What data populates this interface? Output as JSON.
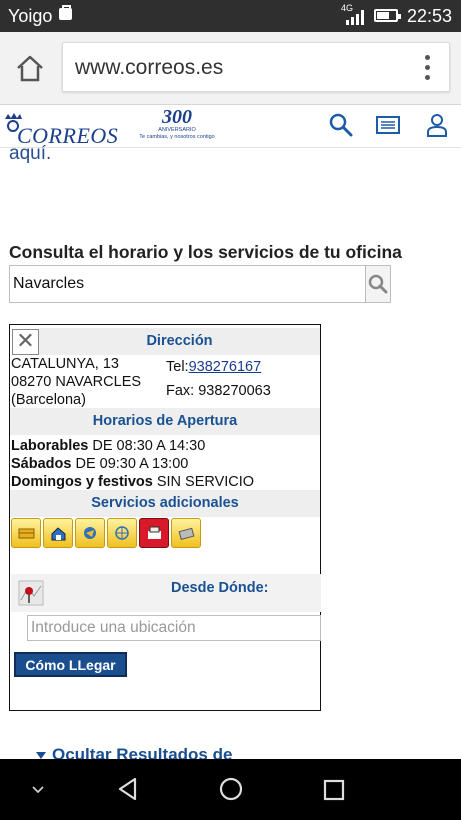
{
  "status_bar": {
    "carrier": "Yoigo",
    "network_type": "4G",
    "time": "22:53",
    "battery_level": 0.65
  },
  "browser": {
    "url": "www.correos.es"
  },
  "site": {
    "logo_text": "CORREOS",
    "anniversary_number": "300",
    "anniversary_label": "ANIVERSARIO",
    "anniversary_tagline": "Te cambias, y nosotros contigo"
  },
  "page": {
    "partial_link_text": "aquí.",
    "section_title": "Consulta el horario y los servicios de tu oficina",
    "search_value": "Navarcles"
  },
  "office": {
    "close_symbol": "✕",
    "address_header": "Dirección",
    "address_lines": [
      "CATALUNYA, 13",
      "08270 NAVARCLES",
      "(Barcelona)"
    ],
    "tel_label": "Tel:",
    "tel_number": "938276167",
    "fax": "Fax: 938270063",
    "hours_header": "Horarios de Apertura",
    "hours": [
      {
        "day": "Laborables",
        "time": "DE 08:30 A 14:30"
      },
      {
        "day": "Sábados",
        "time": "DE 09:30 A 13:00"
      },
      {
        "day": "Domingos y festivos",
        "time": "SIN SERVICIO"
      }
    ],
    "services_header": "Servicios adicionales",
    "services": [
      "cash-service-icon",
      "postbox-service-icon",
      "telegram-service-icon",
      "internet-service-icon",
      "fax-service-icon",
      "payment-service-icon"
    ],
    "from_label": "Desde Dónde:",
    "location_placeholder": "Introduce una ubicación",
    "route_button": "Cómo LLegar"
  },
  "bottom": {
    "toggle_link": "Ocultar Resultados de"
  },
  "colors": {
    "brand_blue": "#1b3f8e",
    "heading_blue": "#1a5192",
    "status_bar": "#2f2f2f",
    "button_blue": "#1a4e8e"
  }
}
